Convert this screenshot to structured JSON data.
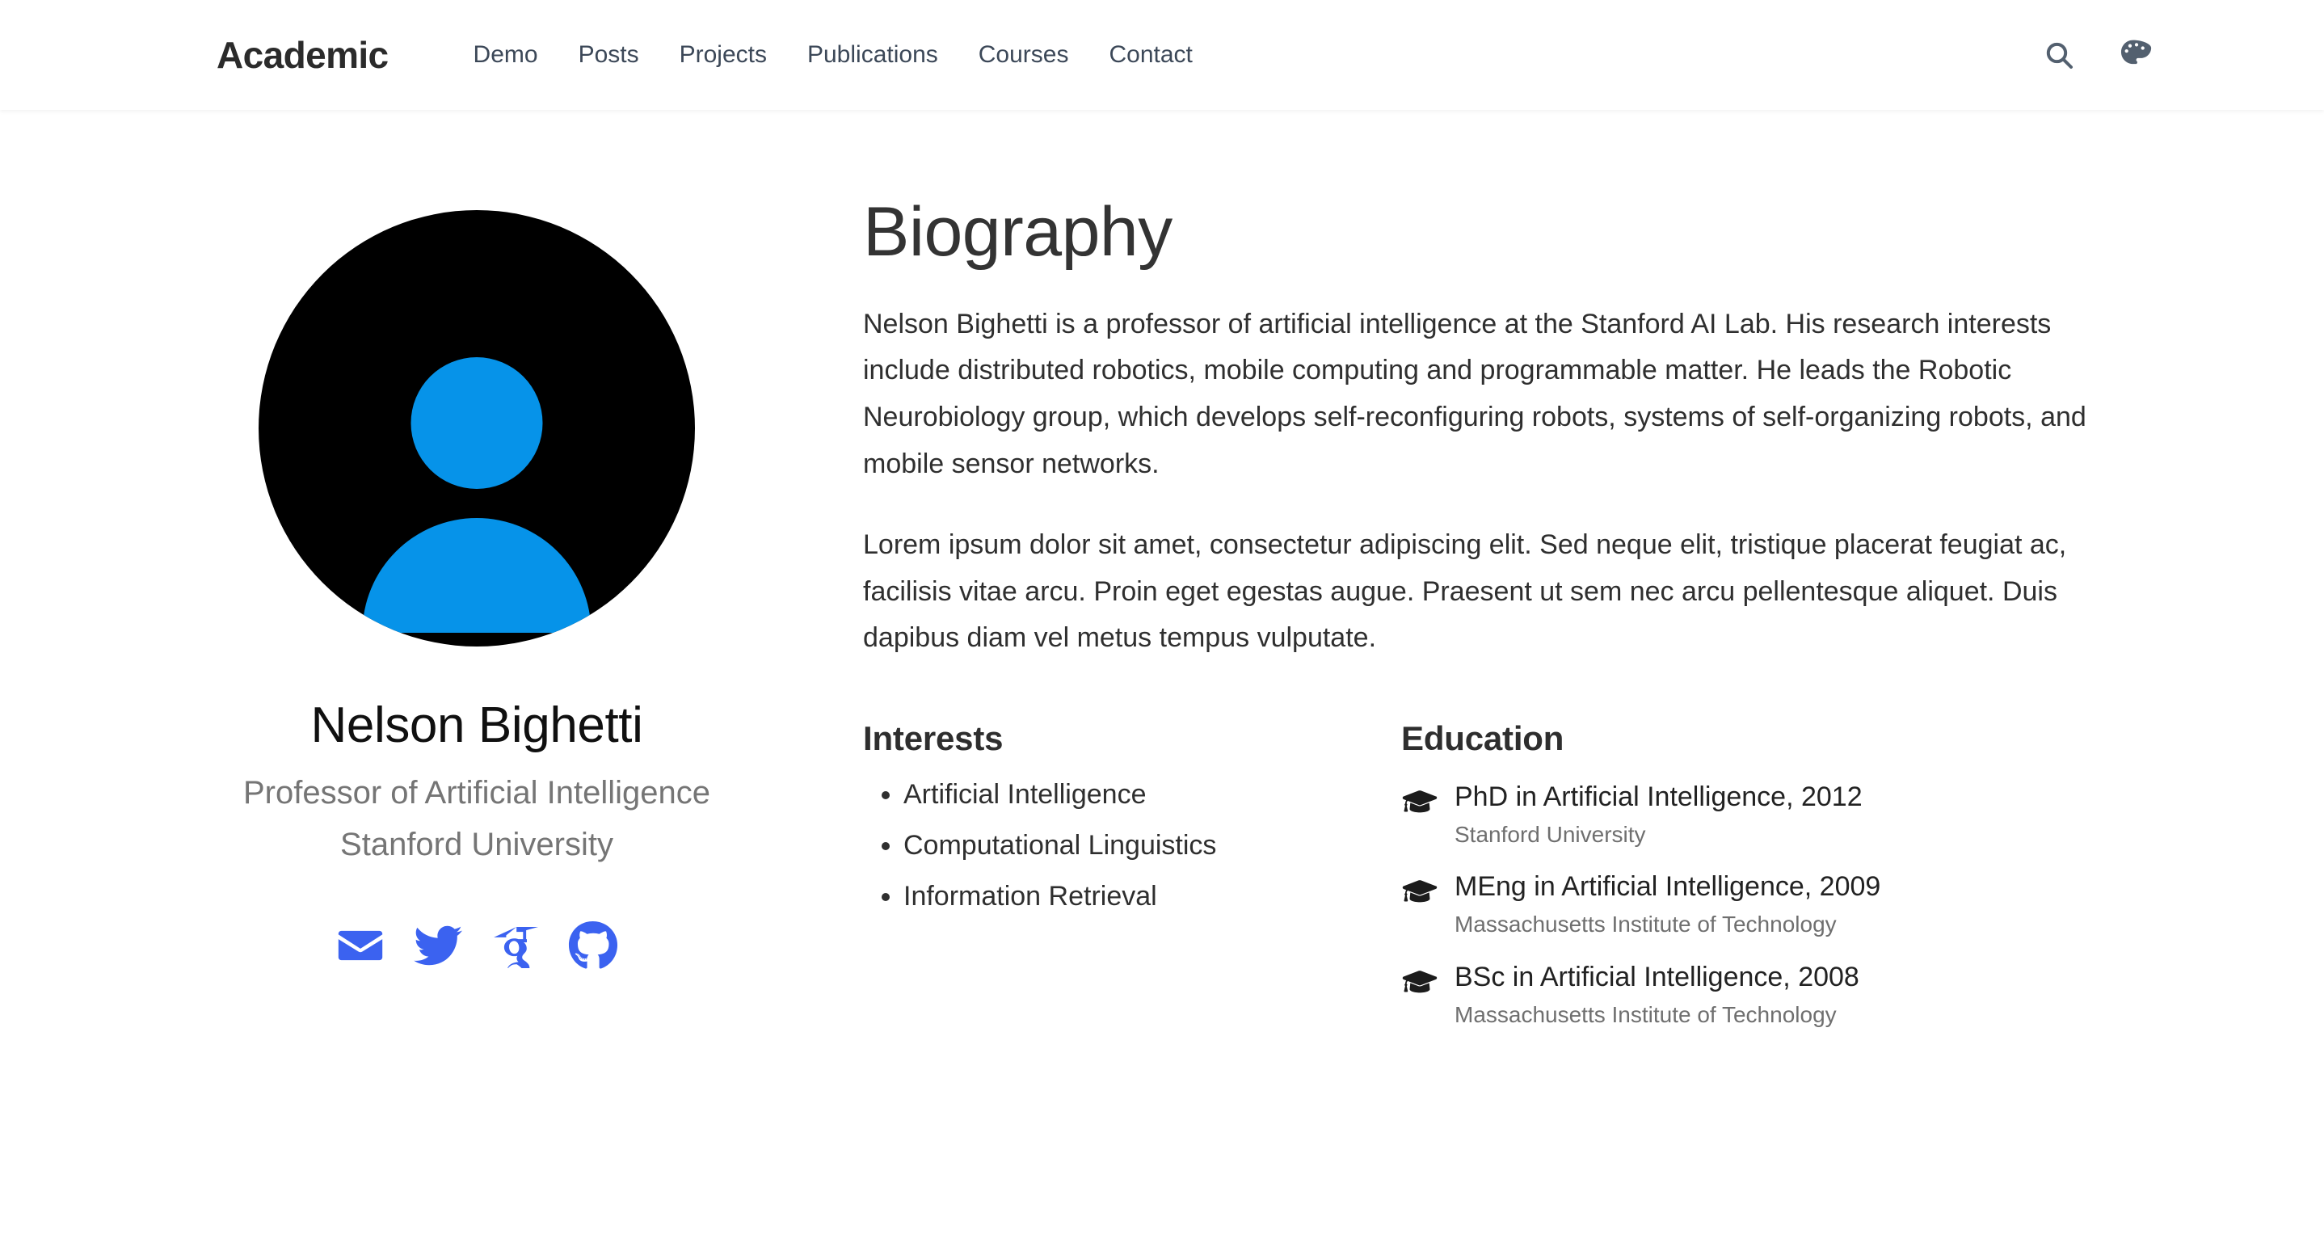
{
  "navbar": {
    "brand": "Academic",
    "links": [
      {
        "label": "Demo"
      },
      {
        "label": "Posts"
      },
      {
        "label": "Projects"
      },
      {
        "label": "Publications"
      },
      {
        "label": "Courses"
      },
      {
        "label": "Contact"
      }
    ],
    "actions": [
      {
        "name": "search-icon",
        "label": "Search"
      },
      {
        "name": "palette-icon",
        "label": "Theme"
      }
    ],
    "link_color": "#3c4858",
    "brand_color": "#2b2b2b",
    "icon_color": "#53606f"
  },
  "profile": {
    "avatar": {
      "icon": "user-avatar-icon",
      "background_color": "#000000",
      "figure_color": "#0693E9"
    },
    "name": "Nelson Bighetti",
    "role": "Professor of Artificial Intelligence",
    "organization": "Stanford University",
    "social_color": "#3B62F0",
    "social": [
      {
        "name": "email-icon",
        "label": "E-mail"
      },
      {
        "name": "twitter-icon",
        "label": "Twitter"
      },
      {
        "name": "google-scholar-icon",
        "label": "Google Scholar"
      },
      {
        "name": "github-icon",
        "label": "GitHub"
      }
    ]
  },
  "biography": {
    "title": "Biography",
    "paragraphs": [
      "Nelson Bighetti is a professor of artificial intelligence at the Stanford AI Lab. His research interests include distributed robotics, mobile computing and programmable matter. He leads the Robotic Neurobiology group, which develops self-reconfiguring robots, systems of self-organizing robots, and mobile sensor networks.",
      "Lorem ipsum dolor sit amet, consectetur adipiscing elit. Sed neque elit, tristique placerat feugiat ac, facilisis vitae arcu. Proin eget egestas augue. Praesent ut sem nec arcu pellentesque aliquet. Duis dapibus diam vel metus tempus vulputate."
    ]
  },
  "interests": {
    "heading": "Interests",
    "items": [
      "Artificial Intelligence",
      "Computational Linguistics",
      "Information Retrieval"
    ]
  },
  "education": {
    "heading": "Education",
    "items": [
      {
        "course": "PhD in Artificial Intelligence, 2012",
        "institution": "Stanford University"
      },
      {
        "course": "MEng in Artificial Intelligence, 2009",
        "institution": "Massachusetts Institute of Technology"
      },
      {
        "course": "BSc in Artificial Intelligence, 2008",
        "institution": "Massachusetts Institute of Technology"
      }
    ]
  }
}
